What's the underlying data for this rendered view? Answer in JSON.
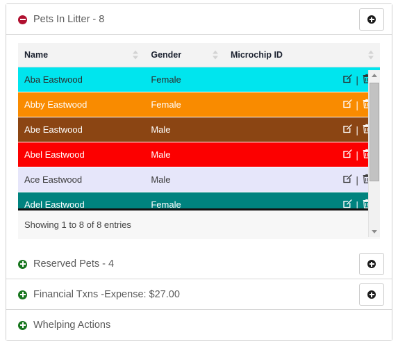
{
  "panels": [
    {
      "id": "pets-in-litter",
      "title": "Pets In Litter - 8",
      "toggle_icon": "minus-circle-icon",
      "expanded": true,
      "add_button": {
        "label": "",
        "icon": "plus-circle-icon"
      }
    },
    {
      "id": "reserved-pets",
      "title": "Reserved Pets - 4",
      "toggle_icon": "plus-circle-icon",
      "expanded": false,
      "add_button": {
        "label": "",
        "icon": "plus-circle-icon"
      }
    },
    {
      "id": "financial-txns",
      "title": "Financial Txns -Expense: $27.00",
      "toggle_icon": "plus-circle-icon",
      "expanded": false,
      "add_button": {
        "label": "",
        "icon": "plus-circle-icon"
      }
    },
    {
      "id": "whelping-actions",
      "title": "Whelping Actions",
      "toggle_icon": "plus-circle-icon",
      "expanded": false,
      "add_button": null
    }
  ],
  "table": {
    "columns": [
      {
        "label": "Name",
        "sortable": true
      },
      {
        "label": "Gender",
        "sortable": true
      },
      {
        "label": "Microchip ID",
        "sortable": true
      }
    ],
    "rows": [
      {
        "name": "Aba Eastwood",
        "gender": "Female",
        "microchip_id": "",
        "row_color": "#00e5ee",
        "text_color": "#2b2b2b",
        "edit_icon": "edit-icon",
        "delete_icon": "trash-icon"
      },
      {
        "name": "Abby Eastwood",
        "gender": "Female",
        "microchip_id": "",
        "row_color": "#f98b00",
        "text_color": "#ffffff",
        "edit_icon": "edit-icon",
        "delete_icon": "trash-icon"
      },
      {
        "name": "Abe Eastwood",
        "gender": "Male",
        "microchip_id": "",
        "row_color": "#8b4513",
        "text_color": "#ffffff",
        "edit_icon": "edit-icon",
        "delete_icon": "trash-icon"
      },
      {
        "name": "Abel Eastwood",
        "gender": "Male",
        "microchip_id": "",
        "row_color": "#fc0000",
        "text_color": "#ffffff",
        "edit_icon": "edit-icon",
        "delete_icon": "trash-icon"
      },
      {
        "name": "Ace Eastwood",
        "gender": "Male",
        "microchip_id": "",
        "row_color": "#e6e6fa",
        "text_color": "#3b3b3b",
        "edit_icon": "edit-icon",
        "delete_icon": "trash-icon"
      },
      {
        "name": "Adel Eastwood",
        "gender": "Female",
        "microchip_id": "",
        "row_color": "#00837f",
        "text_color": "#ffffff",
        "edit_icon": "edit-icon",
        "delete_icon": "trash-icon"
      }
    ],
    "info": "Showing 1 to 8 of 8 entries"
  },
  "colors": {
    "collapse_icon": "#b01030",
    "expand_icon": "#18761f",
    "header_bg": "#f3f3f3",
    "footer_bg": "#f7f7f7",
    "panel_border": "#d0d0d0"
  }
}
